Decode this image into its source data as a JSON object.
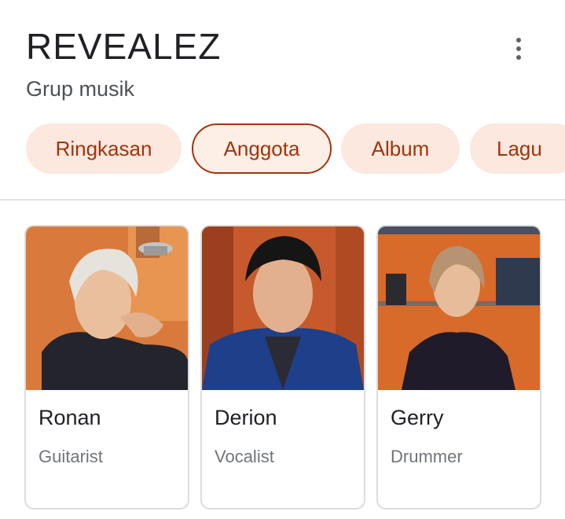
{
  "header": {
    "title": "REVEALEZ",
    "subtitle": "Grup musik",
    "more_icon": "more-vert-icon"
  },
  "tabs": [
    {
      "label": "Ringkasan",
      "active": false
    },
    {
      "label": "Anggota",
      "active": true
    },
    {
      "label": "Album",
      "active": false
    },
    {
      "label": "Lagu",
      "active": false
    }
  ],
  "members": [
    {
      "name": "Ronan",
      "role": "Guitarist"
    },
    {
      "name": "Derion",
      "role": "Vocalist"
    },
    {
      "name": "Gerry",
      "role": "Drummer"
    }
  ],
  "colors": {
    "chip_bg": "#fce8de",
    "chip_text": "#a1350d",
    "active_border": "#a1350d"
  }
}
